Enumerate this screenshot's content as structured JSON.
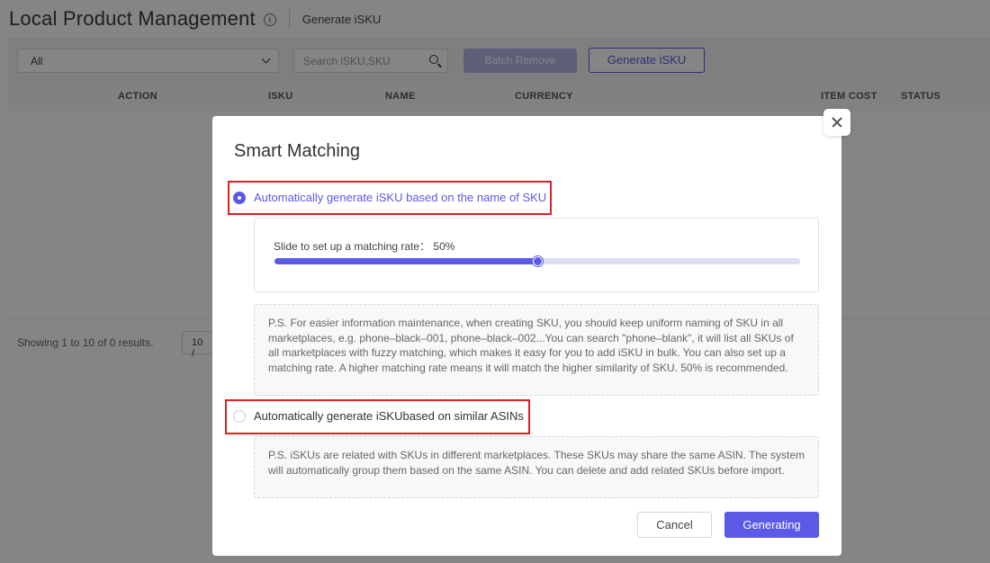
{
  "header": {
    "title": "Local Product Management",
    "link": "Generate iSKU"
  },
  "toolbar": {
    "filter_value": "All",
    "search_placeholder": "Search iSKU,SKU",
    "batch_remove_label": "Batch Remove",
    "generate_label": "Generate iSKU"
  },
  "table": {
    "columns": [
      "ACTION",
      "ISKU",
      "NAME",
      "CURRENCY",
      "ITEM COST",
      "STATUS"
    ]
  },
  "footer": {
    "showing": "Showing 1 to 10 of 0 results.",
    "page_size": "10 /"
  },
  "modal": {
    "title": "Smart Matching",
    "option1": {
      "label": "Automatically generate iSKU based on the name of SKU",
      "selected": true
    },
    "slider": {
      "label": "Slide to set up a matching rate： 50%",
      "value": 0.5
    },
    "note1": "P.S. For easier information maintenance, when creating SKU, you should keep uniform naming of SKU in all marketplaces, e.g. phone–black–001, phone–black–002...You can search \"phone–blank\", it will list all SKUs of all marketplaces with fuzzy matching, which makes it easy for you to add iSKU in bulk. You can also set up a matching rate. A higher matching rate means it will match the higher similarity of SKU. 50% is recommended.",
    "option2": {
      "label": "Automatically generate iSKUbased on similar ASINs",
      "selected": false
    },
    "note2": "P.S. iSKUs are related with SKUs in different marketplaces. These SKUs may share the same ASIN. The system will automatically group them based on the same ASIN. You can delete and add related SKUs before import.",
    "cancel_label": "Cancel",
    "generating_label": "Generating"
  },
  "colors": {
    "accent": "#5a5ae6",
    "highlight": "#e02020"
  }
}
